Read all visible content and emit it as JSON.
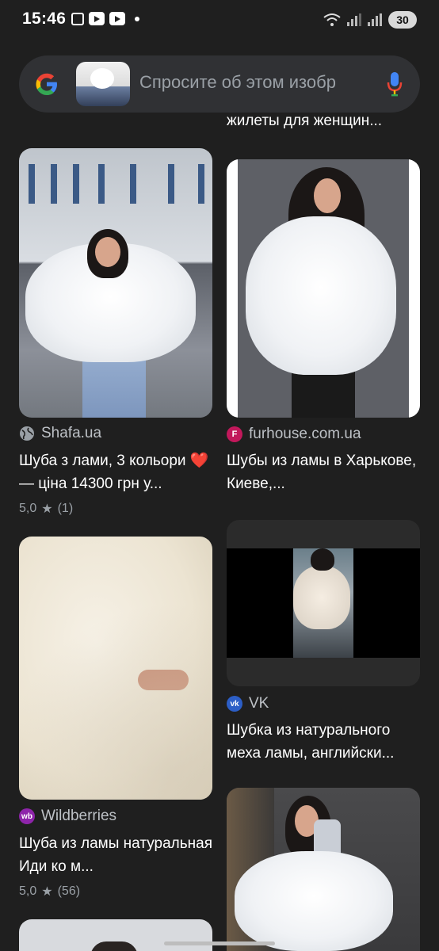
{
  "status_bar": {
    "time": "15:46",
    "battery": "30"
  },
  "search": {
    "placeholder": "Спросите об этом изобр"
  },
  "cut_title": "жилеты для женщин...",
  "cards": [
    {
      "source": "Shafa.ua",
      "title": "Шуба з лами, 3 кольори ❤️ — ціна 14300 грн у...",
      "rating": "5,0",
      "reviews": "(1)"
    },
    {
      "source": "furhouse.com.ua",
      "favicon": "F",
      "title": "Шубы из ламы в Харькове, Киеве,..."
    },
    {
      "source": "Wildberries",
      "favicon": "wb",
      "title": "Шуба из ламы натуральная Иди ко м...",
      "rating": "5,0",
      "reviews": "(56)"
    },
    {
      "source": "VK",
      "favicon": "vk",
      "title": "Шубка из натурального меха ламы, английски..."
    }
  ],
  "colors": {
    "background": "#1f1f1f",
    "search_bg": "#303134",
    "furhouse": "#c2185b",
    "wildberries": "#8e24aa",
    "vk": "#2c5ec6"
  }
}
